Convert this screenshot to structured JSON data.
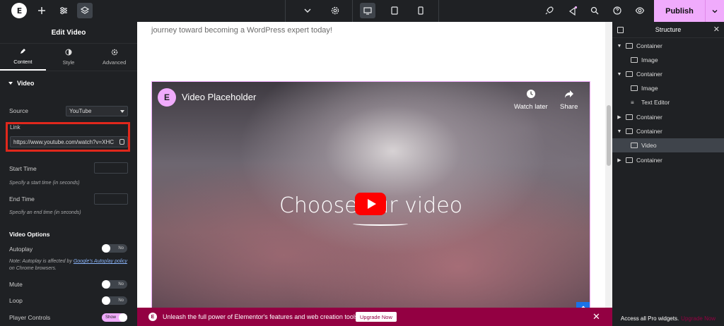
{
  "topbar": {
    "publish_label": "Publish"
  },
  "left_panel": {
    "title": "Edit Video",
    "tabs": [
      {
        "label": "Content"
      },
      {
        "label": "Style"
      },
      {
        "label": "Advanced"
      }
    ],
    "section_video": "Video",
    "source_label": "Source",
    "source_value": "YouTube",
    "link_label": "Link",
    "link_value": "https://www.youtube.com/watch?v=XHC",
    "start_time_label": "Start Time",
    "start_time_hint": "Specify a start time (in seconds)",
    "end_time_label": "End Time",
    "end_time_hint": "Specify an end time (in seconds)",
    "section_options": "Video Options",
    "autoplay_label": "Autoplay",
    "autoplay_toggle": "No",
    "autoplay_note_pre": "Note: Autoplay is affected by",
    "autoplay_note_link": "Google's Autoplay policy",
    "autoplay_note_post": "on Chrome browsers.",
    "mute_label": "Mute",
    "mute_toggle": "No",
    "loop_label": "Loop",
    "loop_toggle": "No",
    "player_controls_label": "Player Controls",
    "player_controls_toggle": "Show"
  },
  "canvas": {
    "intro_text": "journey toward becoming a WordPress expert today!",
    "video": {
      "title": "Video Placeholder",
      "watch_later": "Watch later",
      "share": "Share",
      "center_text_a": "Choose ",
      "center_text_b": "ur video"
    }
  },
  "banner": {
    "text": "Unleash the full power of Elementor's features and web creation tools.",
    "button": "Upgrade Now"
  },
  "structure": {
    "title": "Structure",
    "items": [
      {
        "label": "Container"
      },
      {
        "label": "Image"
      },
      {
        "label": "Container"
      },
      {
        "label": "Image"
      },
      {
        "label": "Text Editor"
      },
      {
        "label": "Container"
      },
      {
        "label": "Container"
      },
      {
        "label": "Video"
      },
      {
        "label": "Container"
      }
    ],
    "footer_text": "Access all Pro widgets.",
    "footer_link": "Upgrade Now"
  },
  "colors": {
    "accent": "#f0abfc",
    "panel_bg": "#1f2124",
    "banner_bg": "#930042",
    "highlight_box": "#e0281c",
    "youtube_red": "#ff0000"
  }
}
